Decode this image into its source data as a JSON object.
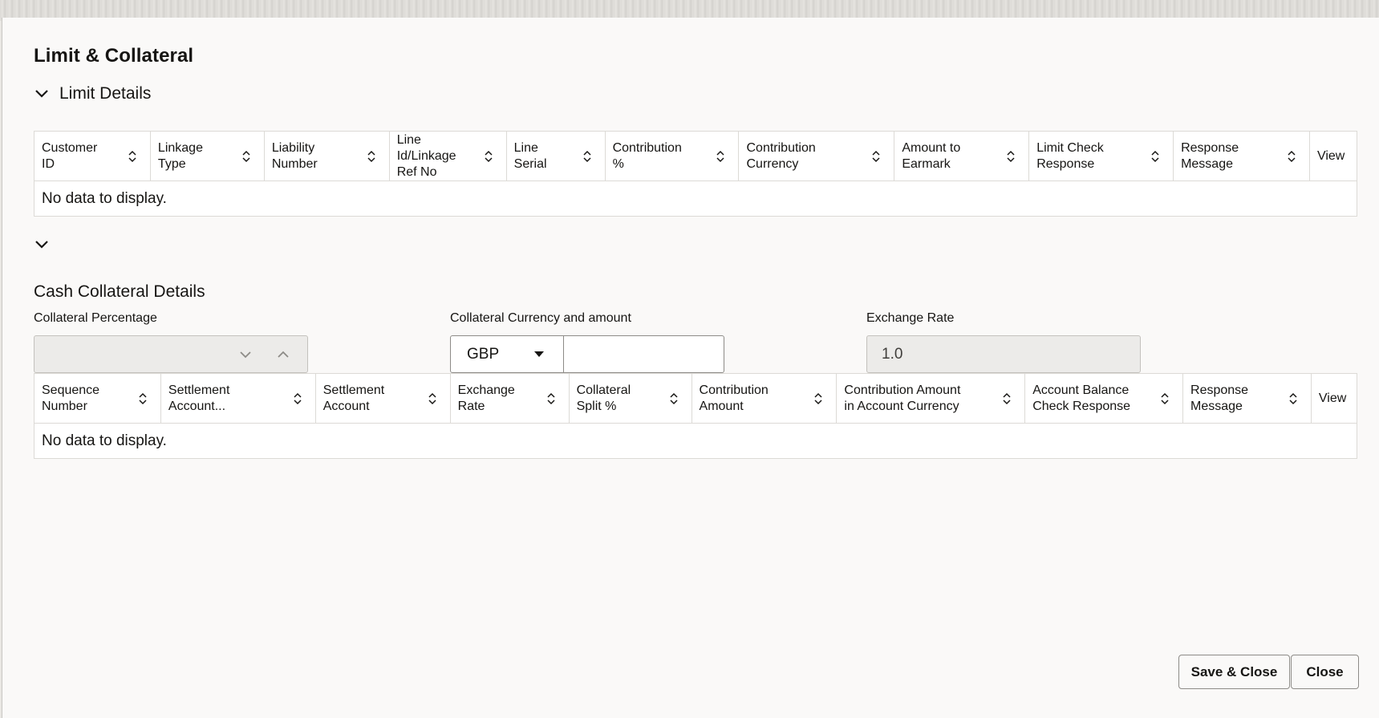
{
  "dialog": {
    "title": "Limit & Collateral"
  },
  "limit_section": {
    "label": "Limit Details",
    "columns": [
      [
        "Customer",
        "ID"
      ],
      [
        "Linkage",
        "Type"
      ],
      [
        "Liability",
        "Number"
      ],
      [
        "Line Id/Linkage",
        "Ref No"
      ],
      [
        "Line",
        "Serial"
      ],
      [
        "Contribution",
        "%"
      ],
      [
        "Contribution",
        "Currency"
      ],
      [
        "Amount to",
        "Earmark"
      ],
      [
        "Limit Check",
        "Response"
      ],
      [
        "Response",
        "Message"
      ],
      [
        "View"
      ]
    ],
    "empty_text": "No data to display."
  },
  "cash_section": {
    "title": "Cash Collateral Details",
    "collateral_percentage_label": "Collateral Percentage",
    "collateral_currency_label": "Collateral Currency and amount",
    "currency_value": "GBP",
    "amount_value": "",
    "exchange_rate_label": "Exchange Rate",
    "exchange_rate_value": "1.0",
    "columns": [
      [
        "Sequence",
        "Number"
      ],
      [
        "Settlement",
        "Account..."
      ],
      [
        "Settlement",
        "Account"
      ],
      [
        "Exchange",
        "Rate"
      ],
      [
        "Collateral",
        "Split %"
      ],
      [
        "Contribution",
        "Amount"
      ],
      [
        "Contribution Amount",
        "in Account Currency"
      ],
      [
        "Account Balance",
        "Check Response"
      ],
      [
        "Response",
        "Message"
      ],
      [
        "View"
      ]
    ],
    "empty_text": "No data to display."
  },
  "footer": {
    "save_close_label": "Save & Close",
    "close_label": "Close"
  },
  "icons": {
    "sort": "sort-up-down-icon",
    "expand": "chevron-down-icon",
    "select_down": "chevron-down-icon",
    "select_up": "chevron-up-icon",
    "dropdown": "caret-down-icon"
  }
}
